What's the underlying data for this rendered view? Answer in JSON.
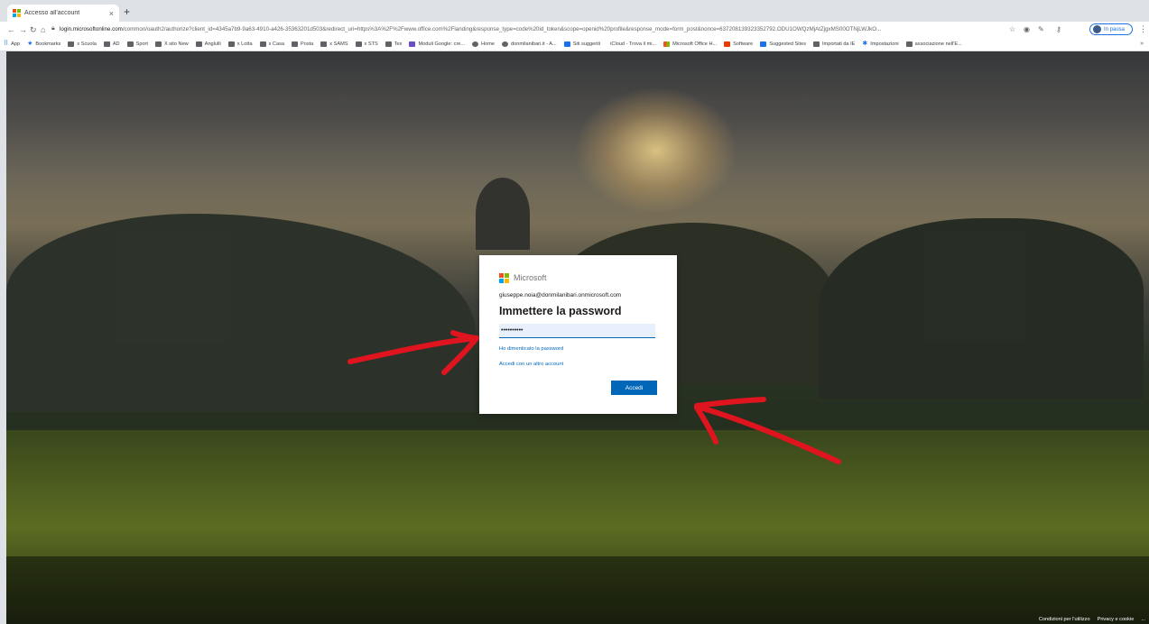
{
  "browser": {
    "tab_title": "Accesso all'account",
    "tab_close": "×",
    "new_tab": "+",
    "url_host": "login.microsoftonline.com",
    "url_path": "/common/oauth2/authorize?client_id=4345a7b9-9a63-4910-a426-35363201d503&redirect_uri=https%3A%2F%2Fwww.office.com%2Flanding&response_type=code%20id_token&scope=openid%20profile&response_mode=form_post&nonce=637208139323352792.ODU1OWQzMjAtZjgxMS00OTNjLWJkO...",
    "profile_status": "In pausa",
    "bookmarks": [
      {
        "label": "App",
        "icon": "apps-icon"
      },
      {
        "label": "Bookmarks",
        "icon": "star-icon"
      },
      {
        "label": "x Scuola",
        "icon": "folder-icon"
      },
      {
        "label": "AD",
        "icon": "folder-icon"
      },
      {
        "label": "Sport",
        "icon": "folder-icon"
      },
      {
        "label": "X sito New",
        "icon": "folder-icon"
      },
      {
        "label": "Anglulli",
        "icon": "folder-icon"
      },
      {
        "label": "x Lotta",
        "icon": "folder-icon"
      },
      {
        "label": "x Casa",
        "icon": "folder-icon"
      },
      {
        "label": "Posta",
        "icon": "folder-icon"
      },
      {
        "label": "x SAMS",
        "icon": "folder-icon"
      },
      {
        "label": "x STS",
        "icon": "folder-icon"
      },
      {
        "label": "Tex",
        "icon": "folder-icon"
      },
      {
        "label": "Moduli Google: cre...",
        "icon": "forms-icon"
      },
      {
        "label": "Home",
        "icon": "globe-icon"
      },
      {
        "label": "donmilanibari.it - A...",
        "icon": "globe-icon"
      },
      {
        "label": "Siti suggeriti",
        "icon": "bing-icon"
      },
      {
        "label": "iCloud - Trova il mi...",
        "icon": "apple-icon"
      },
      {
        "label": "Microsoft Office H...",
        "icon": "ms-icon"
      },
      {
        "label": "Software",
        "icon": "office-icon"
      },
      {
        "label": "Suggested Sites",
        "icon": "bing-icon"
      },
      {
        "label": "Importati da IE",
        "icon": "folder-icon"
      },
      {
        "label": "Impostazioni",
        "icon": "gear-icon"
      },
      {
        "label": "associazione nell'E...",
        "icon": "folder-icon"
      }
    ],
    "bookmarks_more": "»"
  },
  "signin": {
    "brand": "Microsoft",
    "identity": "giuseppe.noia@donmilanibari.onmicrosoft.com",
    "heading": "Immettere la password",
    "password_value": "••••••••••",
    "forgot_link": "Ho dimenticato la password",
    "other_account_link": "Accedi con un altro account",
    "submit_label": "Accedi"
  },
  "footer": {
    "terms": "Condizioni per l'utilizzo",
    "privacy": "Privacy e cookie",
    "more": "..."
  },
  "colors": {
    "accent": "#0067b8",
    "annotation": "#e0141e"
  }
}
